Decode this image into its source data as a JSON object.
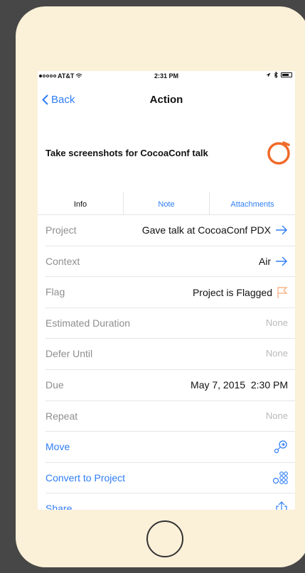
{
  "status_bar": {
    "carrier": "AT&T",
    "time": "2:31 PM"
  },
  "nav": {
    "back_label": "Back",
    "title": "Action"
  },
  "task": {
    "title": "Take screenshots for CocoaConf talk"
  },
  "tabs": [
    {
      "label": "Info",
      "selected": true
    },
    {
      "label": "Note",
      "selected": false
    },
    {
      "label": "Attachments",
      "selected": false
    }
  ],
  "rows": [
    {
      "label": "Project",
      "value": "Gave talk at CocoaConf PDX",
      "icon": "arrow-right-icon"
    },
    {
      "label": "Context",
      "value": "Air",
      "icon": "arrow-right-icon"
    },
    {
      "label": "Flag",
      "value": "Project is Flagged",
      "icon": "flag-icon"
    },
    {
      "label": "Estimated Duration",
      "value": "None"
    },
    {
      "label": "Defer Until",
      "value": "None"
    },
    {
      "label": "Due",
      "value": "May 7, 2015  2:30 PM"
    },
    {
      "label": "Repeat",
      "value": "None"
    }
  ],
  "actions": [
    {
      "label": "Move",
      "icon": "move-icon"
    },
    {
      "label": "Convert to Project",
      "icon": "convert-project-icon"
    },
    {
      "label": "Share",
      "icon": "share-icon"
    }
  ],
  "colors": {
    "accent": "#2f7df6",
    "flag": "#f7b58a",
    "status_ring": "#f06a2a",
    "frame": "#fbf0d8",
    "background": "#474747"
  }
}
